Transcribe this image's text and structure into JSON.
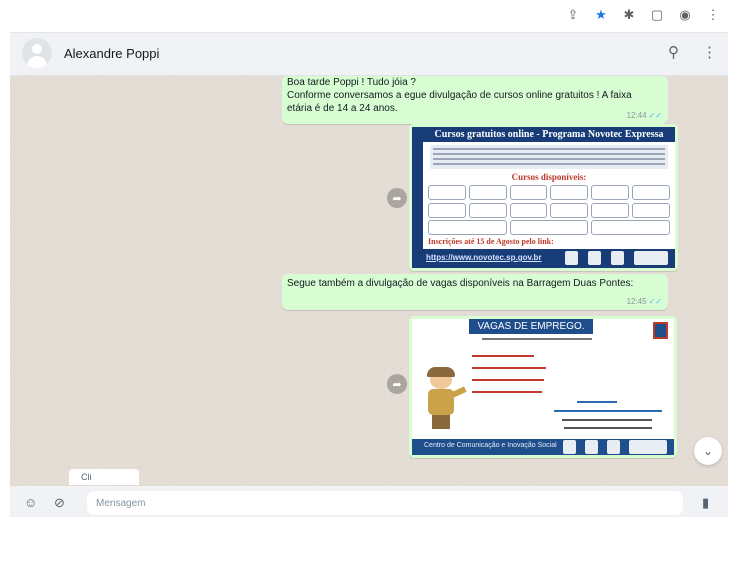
{
  "browser": {
    "icons": [
      "share-icon",
      "star-icon",
      "extensions-icon",
      "sidebar-icon",
      "profile-icon",
      "more-icon"
    ]
  },
  "header": {
    "contact_name": "Alexandre Poppi",
    "icons": [
      "search-icon",
      "menu-icon"
    ]
  },
  "messages": [
    {
      "type": "text",
      "lines": [
        "Boa tarde Poppi ! Tudo jóia ?",
        "Conforme conversamos  a egue divulgação de cursos online gratuitos ! A faixa",
        "etária é de 14 a 24 anos."
      ],
      "time": "12:44"
    },
    {
      "type": "image",
      "flyer": {
        "title": "Cursos gratuitos online - Programa Novotec Expressa",
        "subtitle": "Cursos disponíveis:",
        "deadline": "Inscrições até 15 de Agosto pelo link:",
        "link": "https://www.novotec.sp.gov.br"
      }
    },
    {
      "type": "text",
      "lines": [
        "Segue também a divulgação de vagas disponíveis na Barragem Duas Pontes:"
      ],
      "time": "12:45"
    },
    {
      "type": "image",
      "flyer": {
        "title": "VAGAS DE EMPREGO.",
        "footer": "Centro de Comunicação e Inovação Social"
      }
    }
  ],
  "date_chip": "Cli",
  "compose": {
    "placeholder": "Mensagem",
    "icons": [
      "emoji-icon",
      "attach-icon",
      "mic-icon"
    ]
  },
  "colors": {
    "outgoing_bubble": "#d9fdd3",
    "chat_background": "#e4ddd5",
    "read_tick": "#53bdeb",
    "flyer_navy": "#173c78"
  }
}
